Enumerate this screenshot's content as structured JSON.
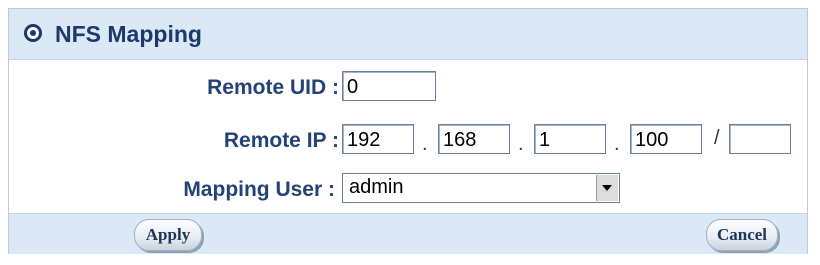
{
  "header": {
    "title": "NFS Mapping",
    "icon": "gear-circle-icon"
  },
  "form": {
    "remote_uid_label": "Remote UID :",
    "remote_uid_value": "0",
    "remote_ip_label": "Remote IP :",
    "ip_octets": [
      "192",
      "168",
      "1",
      "100"
    ],
    "ip_dot": ".",
    "ip_slash": "/",
    "ip_mask": "",
    "mapping_user_label": "Mapping User :",
    "mapping_user_value": "admin"
  },
  "buttons": {
    "apply": "Apply",
    "cancel": "Cancel"
  },
  "colors": {
    "header_bg": "#dbe9f6",
    "label_color": "#234377"
  }
}
